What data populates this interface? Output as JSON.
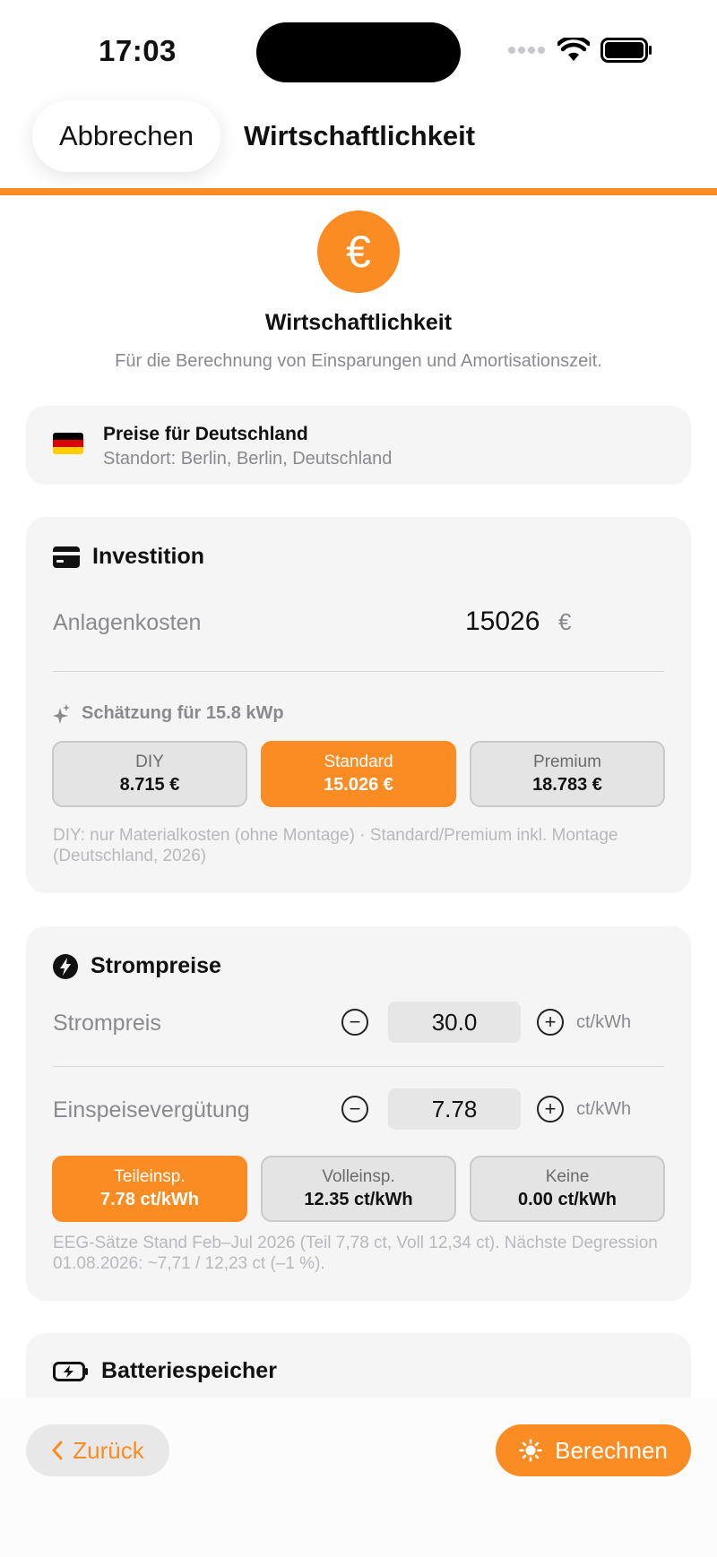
{
  "status": {
    "time": "17:03"
  },
  "nav": {
    "cancel_label": "Abbrechen",
    "title": "Wirtschaftlichkeit"
  },
  "hero": {
    "icon_glyph": "€",
    "title": "Wirtschaftlichkeit",
    "subtitle": "Für die Berechnung von Einsparungen und Amortisationszeit."
  },
  "country": {
    "title": "Preise für Deutschland",
    "subtitle": "Standort: Berlin, Berlin, Deutschland"
  },
  "investment": {
    "heading": "Investition",
    "cost_label": "Anlagenkosten",
    "cost_value": "15026",
    "cost_unit": "€",
    "estimate_label": "Schätzung für 15.8 kWp",
    "options": [
      {
        "name": "DIY",
        "value": "8.715 €",
        "active": false
      },
      {
        "name": "Standard",
        "value": "15.026 €",
        "active": true
      },
      {
        "name": "Premium",
        "value": "18.783 €",
        "active": false
      }
    ],
    "note": "DIY: nur Materialkosten (ohne Montage) · Standard/Premium inkl. Montage (Deutschland, 2026)"
  },
  "prices": {
    "heading": "Strompreise",
    "electricity_label": "Strompreis",
    "electricity_value": "30.0",
    "feedin_label": "Einspeisevergütung",
    "feedin_value": "7.78",
    "unit": "ct/kWh",
    "options": [
      {
        "name": "Teileinsp.",
        "value": "7.78 ct/kWh",
        "active": true
      },
      {
        "name": "Volleinsp.",
        "value": "12.35 ct/kWh",
        "active": false
      },
      {
        "name": "Keine",
        "value": "0.00 ct/kWh",
        "active": false
      }
    ],
    "note": "EEG-Sätze Stand Feb–Jul 2026 (Teil 7,78 ct, Voll 12,34 ct). Nächste Degression 01.08.2026: ~7,71 / 12,23 ct (–1 %)."
  },
  "battery": {
    "heading": "Batteriespeicher"
  },
  "footer": {
    "back_label": "Zurück",
    "calculate_label": "Berechnen"
  },
  "colors": {
    "accent": "#fb8c23",
    "card": "#f5f5f5"
  }
}
